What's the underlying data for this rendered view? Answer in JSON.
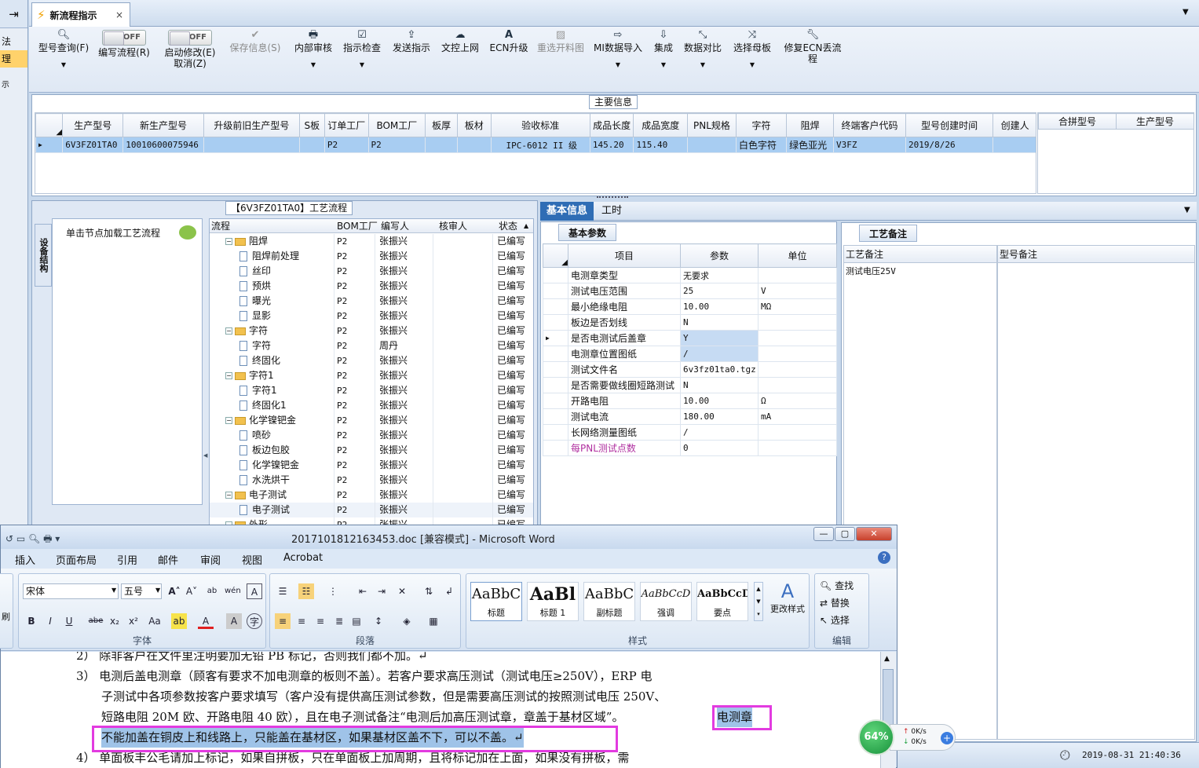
{
  "left_strip": {
    "items": [
      "法",
      "理",
      "示"
    ]
  },
  "tab": {
    "label": "新流程指示",
    "close": "×"
  },
  "toolbar": {
    "model_query": "型号查询(F)",
    "toggle1_state": "OFF",
    "toggle1_label": "编写流程(R)",
    "toggle2_state": "OFF",
    "toggle2_label": "启动修改(E)",
    "toggle2_sub": "取消(Z)",
    "save": "保存信息(S)",
    "internal_review": "内部审核",
    "indicate_check": "指示检查",
    "send": "发送指示",
    "upload": "文控上网",
    "ecn": "ECN升级",
    "reselect": "重选开料图",
    "mi_import": "MI数据导入",
    "integrate": "集成",
    "compare": "数据对比",
    "choose_board": "选择母板",
    "repair": "修复ECN丢流程"
  },
  "main_info": {
    "legend": "主要信息",
    "columns": [
      "生产型号",
      "新生产型号",
      "升级前旧生产型号",
      "S板",
      "订单工厂",
      "BOM工厂",
      "板厚",
      "板材",
      "验收标准",
      "成品长度",
      "成品宽度",
      "PNL规格",
      "字符",
      "阻焊",
      "终端客户代码",
      "型号创建时间",
      "创建人"
    ],
    "row": [
      "6V3FZ01TA0",
      "10010600075946",
      "",
      "",
      "P2",
      "P2",
      "",
      "",
      "IPC-6012 II 级",
      "145.20",
      "115.40",
      "",
      "白色字符",
      "绿色亚光",
      "V3FZ",
      "2019/8/26",
      ""
    ],
    "merge_columns": [
      "合拼型号",
      "生产型号"
    ]
  },
  "process": {
    "legend": "【6V3FZ01TA0】工艺流程",
    "side_tab": "设备结构",
    "hint": "单击节点加载工艺流程",
    "columns": [
      "流程",
      "BOM工厂",
      "编写人",
      "核审人",
      "状态"
    ],
    "rows": [
      {
        "name": "阻焊",
        "type": "folder",
        "bom": "P2",
        "writer": "张振兴",
        "status": "已编写"
      },
      {
        "name": "阻焊前处理",
        "type": "doc",
        "bom": "P2",
        "writer": "张振兴",
        "status": "已编写"
      },
      {
        "name": "丝印",
        "type": "doc",
        "bom": "P2",
        "writer": "张振兴",
        "status": "已编写"
      },
      {
        "name": "预烘",
        "type": "doc",
        "bom": "P2",
        "writer": "张振兴",
        "status": "已编写"
      },
      {
        "name": "曝光",
        "type": "doc",
        "bom": "P2",
        "writer": "张振兴",
        "status": "已编写"
      },
      {
        "name": "显影",
        "type": "doc",
        "bom": "P2",
        "writer": "张振兴",
        "status": "已编写"
      },
      {
        "name": "字符",
        "type": "folder",
        "bom": "P2",
        "writer": "张振兴",
        "status": "已编写"
      },
      {
        "name": "字符",
        "type": "doc",
        "bom": "P2",
        "writer": "周丹",
        "status": "已编写"
      },
      {
        "name": "终固化",
        "type": "doc",
        "bom": "P2",
        "writer": "张振兴",
        "status": "已编写"
      },
      {
        "name": "字符1",
        "type": "folder",
        "bom": "P2",
        "writer": "张振兴",
        "status": "已编写"
      },
      {
        "name": "字符1",
        "type": "doc",
        "bom": "P2",
        "writer": "张振兴",
        "status": "已编写"
      },
      {
        "name": "终固化1",
        "type": "doc",
        "bom": "P2",
        "writer": "张振兴",
        "status": "已编写"
      },
      {
        "name": "化学镍钯金",
        "type": "folder",
        "bom": "P2",
        "writer": "张振兴",
        "status": "已编写"
      },
      {
        "name": "喷砂",
        "type": "doc",
        "bom": "P2",
        "writer": "张振兴",
        "status": "已编写"
      },
      {
        "name": "板边包胶",
        "type": "doc",
        "bom": "P2",
        "writer": "张振兴",
        "status": "已编写"
      },
      {
        "name": "化学镍钯金",
        "type": "doc",
        "bom": "P2",
        "writer": "张振兴",
        "status": "已编写"
      },
      {
        "name": "水洗烘干",
        "type": "doc",
        "bom": "P2",
        "writer": "张振兴",
        "status": "已编写"
      },
      {
        "name": "电子测试",
        "type": "folder",
        "bom": "P2",
        "writer": "张振兴",
        "status": "已编写"
      },
      {
        "name": "电子测试",
        "type": "doc",
        "bom": "P2",
        "writer": "张振兴",
        "status": "已编写"
      },
      {
        "name": "外形",
        "type": "folder",
        "bom": "P2",
        "writer": "张振兴",
        "status": "已编写"
      }
    ]
  },
  "right_tabs": {
    "tab1": "基本信息",
    "tab2": "工时"
  },
  "basic_params": {
    "subtab": "基本参数",
    "columns": [
      "项目",
      "参数",
      "单位"
    ],
    "rows": [
      {
        "item": "电测章类型",
        "value": "无要求",
        "unit": ""
      },
      {
        "item": "测试电压范围",
        "value": "25",
        "unit": "V"
      },
      {
        "item": "最小绝缘电阻",
        "value": "10.00",
        "unit": "MΩ"
      },
      {
        "item": "板边是否划线",
        "value": "N",
        "unit": ""
      },
      {
        "item": "是否电测试后盖章",
        "value": "Y",
        "unit": ""
      },
      {
        "item": "电测章位置图纸",
        "value": "/",
        "unit": ""
      },
      {
        "item": "测试文件名",
        "value": "6v3fz01ta0.tgz",
        "unit": ""
      },
      {
        "item": "是否需要做线圈短路测试",
        "value": "N",
        "unit": ""
      },
      {
        "item": "开路电阻",
        "value": "10.00",
        "unit": "Ω"
      },
      {
        "item": "测试电流",
        "value": "180.00",
        "unit": "mA"
      },
      {
        "item": "长网络测量图纸",
        "value": "/",
        "unit": ""
      },
      {
        "item": "每PNL测试点数",
        "value": "0",
        "unit": ""
      }
    ]
  },
  "notes": {
    "subtab": "工艺备注",
    "col1": "工艺备注",
    "col2": "型号备注",
    "text1": "测试电压25V"
  },
  "status": {
    "datetime": "2019-08-31 21:40:36"
  },
  "speed": {
    "percent": "64%",
    "up": "0K/s",
    "down": "0K/s"
  },
  "word": {
    "title": "2017101812163453.doc [兼容模式] - Microsoft Word",
    "menu": [
      "插入",
      "页面布局",
      "引用",
      "邮件",
      "审阅",
      "视图",
      "Acrobat"
    ],
    "font_name": "宋体",
    "font_size": "五号",
    "groups": {
      "font": "字体",
      "paragraph": "段落",
      "styles": "样式",
      "edit": "编辑"
    },
    "styles": [
      {
        "preview": "AaBbC",
        "name": "标题"
      },
      {
        "preview": "AaBl",
        "name": "标题 1"
      },
      {
        "preview": "AaBbC",
        "name": "副标题"
      },
      {
        "preview": "AaBbCcD",
        "name": "强调"
      },
      {
        "preview": "AaBbCcD",
        "name": "要点"
      }
    ],
    "change_styles": "更改样式",
    "find": "查找",
    "replace": "替换",
    "select": "选择",
    "doc_lines": [
      "2） 除非客户在文件里注明要加无铅 PB 标记，否则我们都不加。↵",
      "3） 电测后盖电测章（顾客有要求不加电测章的板则不盖）。若客户要求高压测试（测试电压≥250V），ERP 电",
      "子测试中各项参数按客户要求填写（客户没有提供高压测试参数，但是需要高压测试的按照测试电压 250V、",
      "短路电阻 20M 欧、开路电阻 40 欧），且在电子测试备注“电测后加高压测试章，章盖于基材区域”。",
      "电测章",
      "不能加盖在铜皮上和线路上，只能盖在基材区，如果基材区盖不下，可以不盖。↵",
      "4） 单面板丰公毛请加上标记，如果自拼板，只在单面板上加周期，且将标记加在上面，如果没有拼板，需"
    ]
  }
}
